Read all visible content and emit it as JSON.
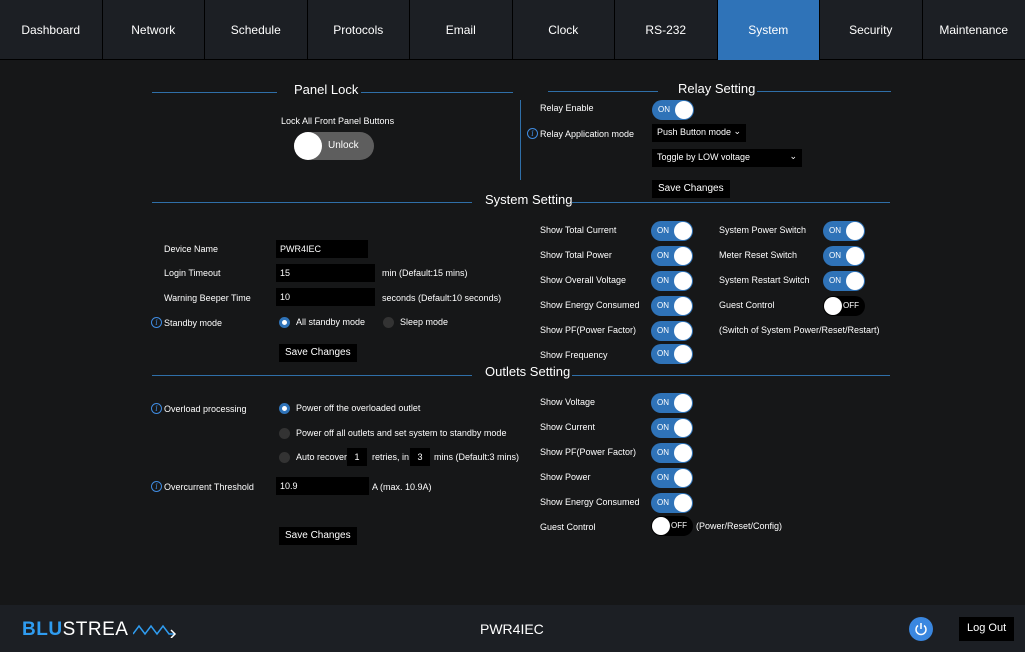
{
  "nav": {
    "tabs": [
      {
        "label": "Dashboard"
      },
      {
        "label": "Network"
      },
      {
        "label": "Schedule"
      },
      {
        "label": "Protocols"
      },
      {
        "label": "Email"
      },
      {
        "label": "Clock"
      },
      {
        "label": "RS-232"
      },
      {
        "label": "System"
      },
      {
        "label": "Security"
      },
      {
        "label": "Maintenance"
      }
    ],
    "active": "System"
  },
  "panel_lock": {
    "title": "Panel Lock",
    "label": "Lock All Front Panel Buttons",
    "toggle_label": "Unlock"
  },
  "relay": {
    "title": "Relay Setting",
    "enable_label": "Relay Enable",
    "enable_state": "ON",
    "mode_label": "Relay Application mode",
    "mode_value": "Push Button mode",
    "trigger_value": "Toggle by LOW voltage",
    "save_label": "Save Changes"
  },
  "system": {
    "title": "System Setting",
    "device_name_label": "Device Name",
    "device_name_value": "PWR4IEC",
    "login_timeout_label": "Login Timeout",
    "login_timeout_value": "15",
    "login_timeout_hint": "min (Default:15 mins)",
    "beeper_label": "Warning Beeper Time",
    "beeper_value": "10",
    "beeper_hint": "seconds (Default:10 seconds)",
    "standby_label": "Standby mode",
    "standby_opt1": "All standby mode",
    "standby_opt2": "Sleep mode",
    "save_label": "Save Changes",
    "show": [
      {
        "label": "Show Total Current",
        "state": "ON"
      },
      {
        "label": "Show Total Power",
        "state": "ON"
      },
      {
        "label": "Show Overall Voltage",
        "state": "ON"
      },
      {
        "label": "Show Energy Consumed",
        "state": "ON"
      },
      {
        "label": "Show PF(Power Factor)",
        "state": "ON"
      },
      {
        "label": "Show Frequency",
        "state": "ON"
      }
    ],
    "switches": [
      {
        "label": "System Power Switch",
        "state": "ON"
      },
      {
        "label": "Meter Reset Switch",
        "state": "ON"
      },
      {
        "label": "System Restart Switch",
        "state": "ON"
      },
      {
        "label": "Guest Control",
        "state": "OFF"
      }
    ],
    "switch_note": "(Switch of System Power/Reset/Restart)"
  },
  "outlets": {
    "title": "Outlets Setting",
    "overload_label": "Overload processing",
    "opt1": "Power off the overloaded outlet",
    "opt2": "Power off all outlets and set system to standby mode",
    "opt3_prefix": "Auto recover",
    "retries_value": "1",
    "retries_text": "retries, in",
    "mins_value": "3",
    "mins_text": "mins (Default:3 mins)",
    "threshold_label": "Overcurrent Threshold",
    "threshold_value": "10.9",
    "threshold_hint": "A (max. 10.9A)",
    "save_label": "Save Changes",
    "show": [
      {
        "label": "Show Voltage",
        "state": "ON"
      },
      {
        "label": "Show Current",
        "state": "ON"
      },
      {
        "label": "Show PF(Power Factor)",
        "state": "ON"
      },
      {
        "label": "Show Power",
        "state": "ON"
      },
      {
        "label": "Show Energy Consumed",
        "state": "ON"
      },
      {
        "label": "Guest Control",
        "state": "OFF"
      }
    ],
    "guest_note": "(Power/Reset/Config)"
  },
  "footer": {
    "logo_a": "BLU",
    "logo_b": "STREA",
    "device": "PWR4IEC",
    "logout_label": "Log Out"
  },
  "colors": {
    "accent": "#2f73b8",
    "background": "#16181b"
  }
}
